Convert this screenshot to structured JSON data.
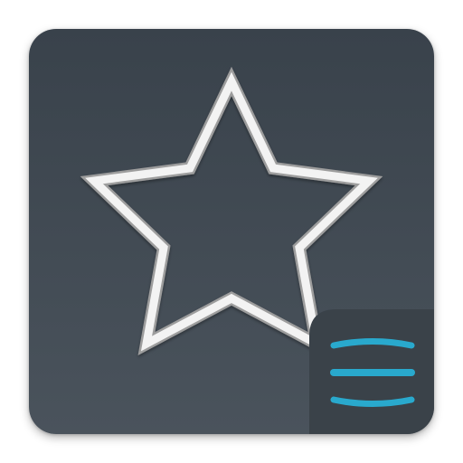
{
  "app_icon": {
    "name": "Starred Items",
    "colors": {
      "background_top": "#39424b",
      "background_bottom": "#4a535c",
      "star_outline": "#f2f2f2",
      "star_shadow": "#9a9a9a",
      "badge_background": "#3a4249",
      "badge_accent": "#29a9cd"
    },
    "icons": {
      "main": "star-outline-icon",
      "badge": "stacked-lines-icon"
    }
  }
}
